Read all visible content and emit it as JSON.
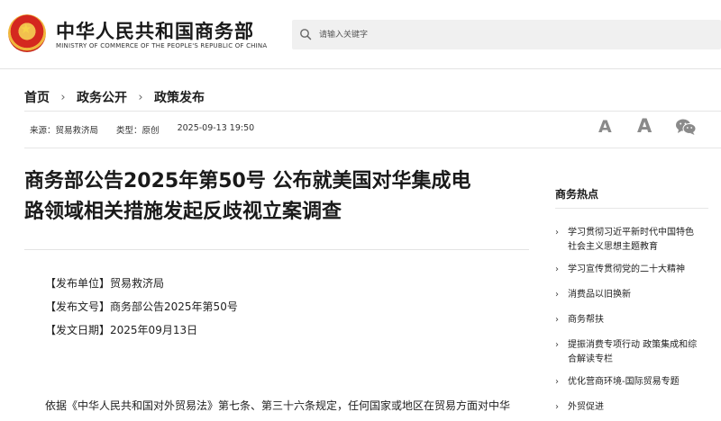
{
  "header": {
    "ministry_name": "中华人民共和国商务部",
    "ministry_en": "MINISTRY OF COMMERCE OF THE PEOPLE'S REPUBLIC OF CHINA",
    "search_placeholder": "请输入关键字",
    "search_icon": "search-icon"
  },
  "breadcrumb": [
    "首页",
    "政务公开",
    "政策发布"
  ],
  "meta": {
    "source_label": "来源：",
    "source_value": "贸易救济局",
    "type_label": "类型：",
    "type_value": "原创",
    "datetime": "2025-09-13 19:50",
    "font_small": "A",
    "font_large": "A",
    "share_icon": "wechat-icon"
  },
  "article": {
    "title_line1": "商务部公告2025年第50号 公布就美国对华集成电",
    "title_line2": "路领域相关措施发起反歧视立案调查",
    "info": [
      {
        "key": "【发布单位】",
        "value": "贸易救济局"
      },
      {
        "key": "【发布文号】",
        "value": "商务部公告2025年第50号"
      },
      {
        "key": "【发文日期】",
        "value": "2025年09月13日"
      }
    ],
    "body_first_line": "依据《中华人民共和国对外贸易法》第七条、第三十六条规定，任何国家或地区在贸易方面对中华"
  },
  "sidebar": {
    "title": "商务热点",
    "items": [
      {
        "line1": "学习贯彻习近平新时代中国特色",
        "line2": "社会主义思想主题教育"
      },
      {
        "line1": "学习宣传贯彻党的二十大精神",
        "line2": ""
      },
      {
        "line1": "消费品以旧换新",
        "line2": ""
      },
      {
        "line1": "商务帮扶",
        "line2": ""
      },
      {
        "line1": "提振消费专项行动 政策集成和综",
        "line2": "合解读专栏"
      },
      {
        "line1": "优化营商环境-国际贸易专题",
        "line2": ""
      },
      {
        "line1": "外贸促进",
        "line2": ""
      }
    ]
  },
  "colors": {
    "text": "#222222",
    "emblem_red": "#d4281f",
    "emblem_gold": "#f2c14e",
    "search_bg": "#f0f0f0",
    "icon_grey": "#8a8a8a"
  }
}
